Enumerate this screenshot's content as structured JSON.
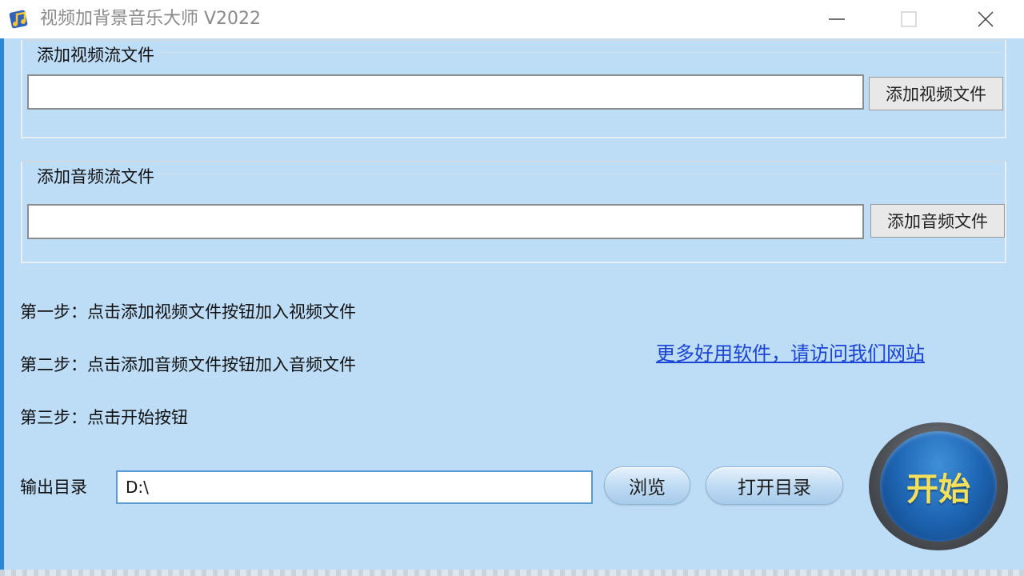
{
  "window": {
    "title": "视频加背景音乐大师 V2022"
  },
  "video_group": {
    "legend": "添加视频流文件",
    "path_value": "",
    "button_label": "添加视频文件"
  },
  "audio_group": {
    "legend": "添加音频流文件",
    "path_value": "",
    "button_label": "添加音频文件"
  },
  "steps": [
    "第一步：点击添加视频文件按钮加入视频文件",
    "第二步：点击添加音频文件按钮加入音频文件",
    "第三步：点击开始按钮"
  ],
  "link": {
    "label": "更多好用软件，请访问我们网站"
  },
  "output": {
    "label": "输出目录",
    "value": "D:\\",
    "browse_label": "浏览",
    "open_dir_label": "打开目录"
  },
  "start_button": {
    "label": "开始"
  },
  "colors": {
    "background": "#bddcf5",
    "link": "#1a45d6",
    "start_text": "#f4e05a",
    "start_blue": "#1e66b4"
  },
  "icons": {
    "app": "music-note-app-icon",
    "minimize": "minimize-icon",
    "maximize": "maximize-icon",
    "close": "close-icon"
  }
}
